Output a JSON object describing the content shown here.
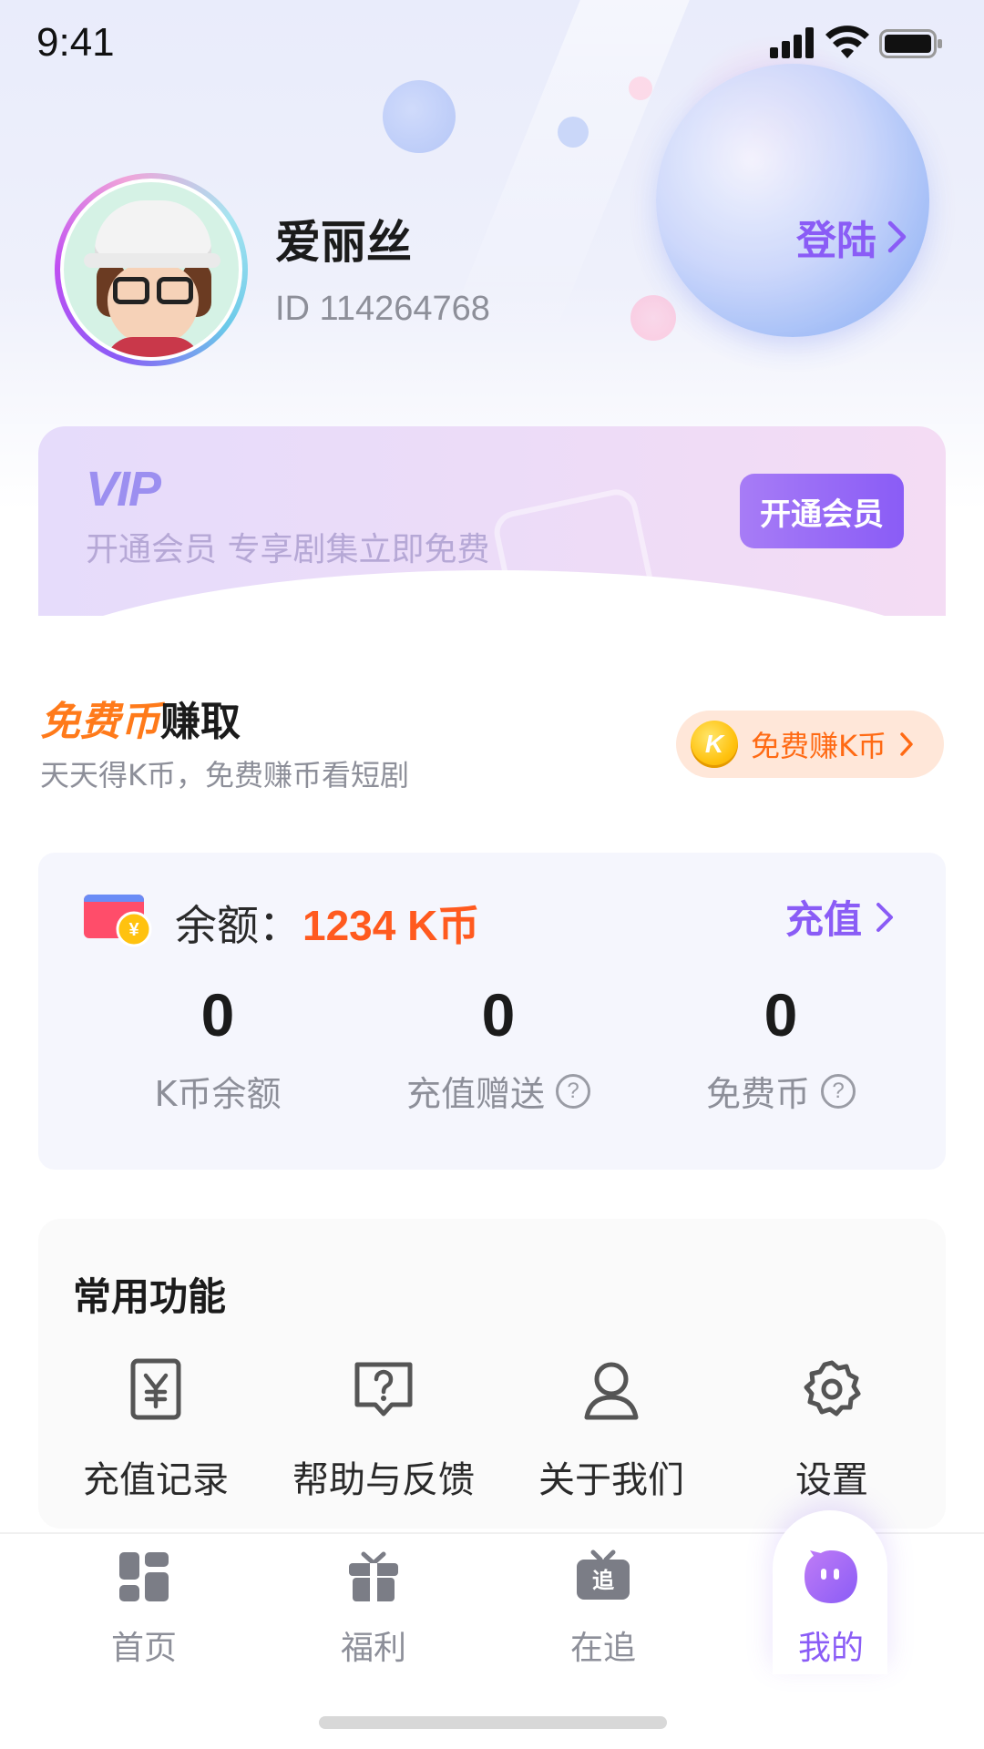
{
  "status_bar": {
    "time": "9:41"
  },
  "profile": {
    "name": "爱丽丝",
    "id_text": "ID 114264768",
    "login_label": "登陆"
  },
  "vip": {
    "logo": "VIP",
    "description": "开通会员   专享剧集立即免费",
    "button_label": "开通会员"
  },
  "earn": {
    "title_highlight": "免费币",
    "title_rest": "赚取",
    "subtitle": "天天得K币，免费赚币看短剧",
    "button_label": "免费赚K币",
    "coin_letter": "K"
  },
  "balance": {
    "label": "余额：",
    "value": "1234 K币",
    "recharge_label": "充值",
    "stats": [
      {
        "value": "0",
        "label": "K币余额",
        "help": false
      },
      {
        "value": "0",
        "label": "充值赠送",
        "help": true
      },
      {
        "value": "0",
        "label": "免费币",
        "help": true
      }
    ]
  },
  "functions": {
    "title": "常用功能",
    "items": [
      {
        "label": "充值记录",
        "icon": "yuan-receipt-icon"
      },
      {
        "label": "帮助与反馈",
        "icon": "help-chat-icon"
      },
      {
        "label": "关于我们",
        "icon": "user-icon"
      },
      {
        "label": "设置",
        "icon": "gear-icon"
      }
    ]
  },
  "tab_bar": {
    "items": [
      {
        "label": "首页",
        "icon": "home-grid-icon",
        "active": false
      },
      {
        "label": "福利",
        "icon": "gift-icon",
        "active": false
      },
      {
        "label": "在追",
        "icon": "tv-follow-icon",
        "active": false,
        "icon_text": "追"
      },
      {
        "label": "我的",
        "icon": "mine-face-icon",
        "active": true
      }
    ]
  },
  "colors": {
    "accent": "#8a5cf6",
    "orange": "#ff7a1a",
    "balance_red": "#ff5a1f"
  }
}
